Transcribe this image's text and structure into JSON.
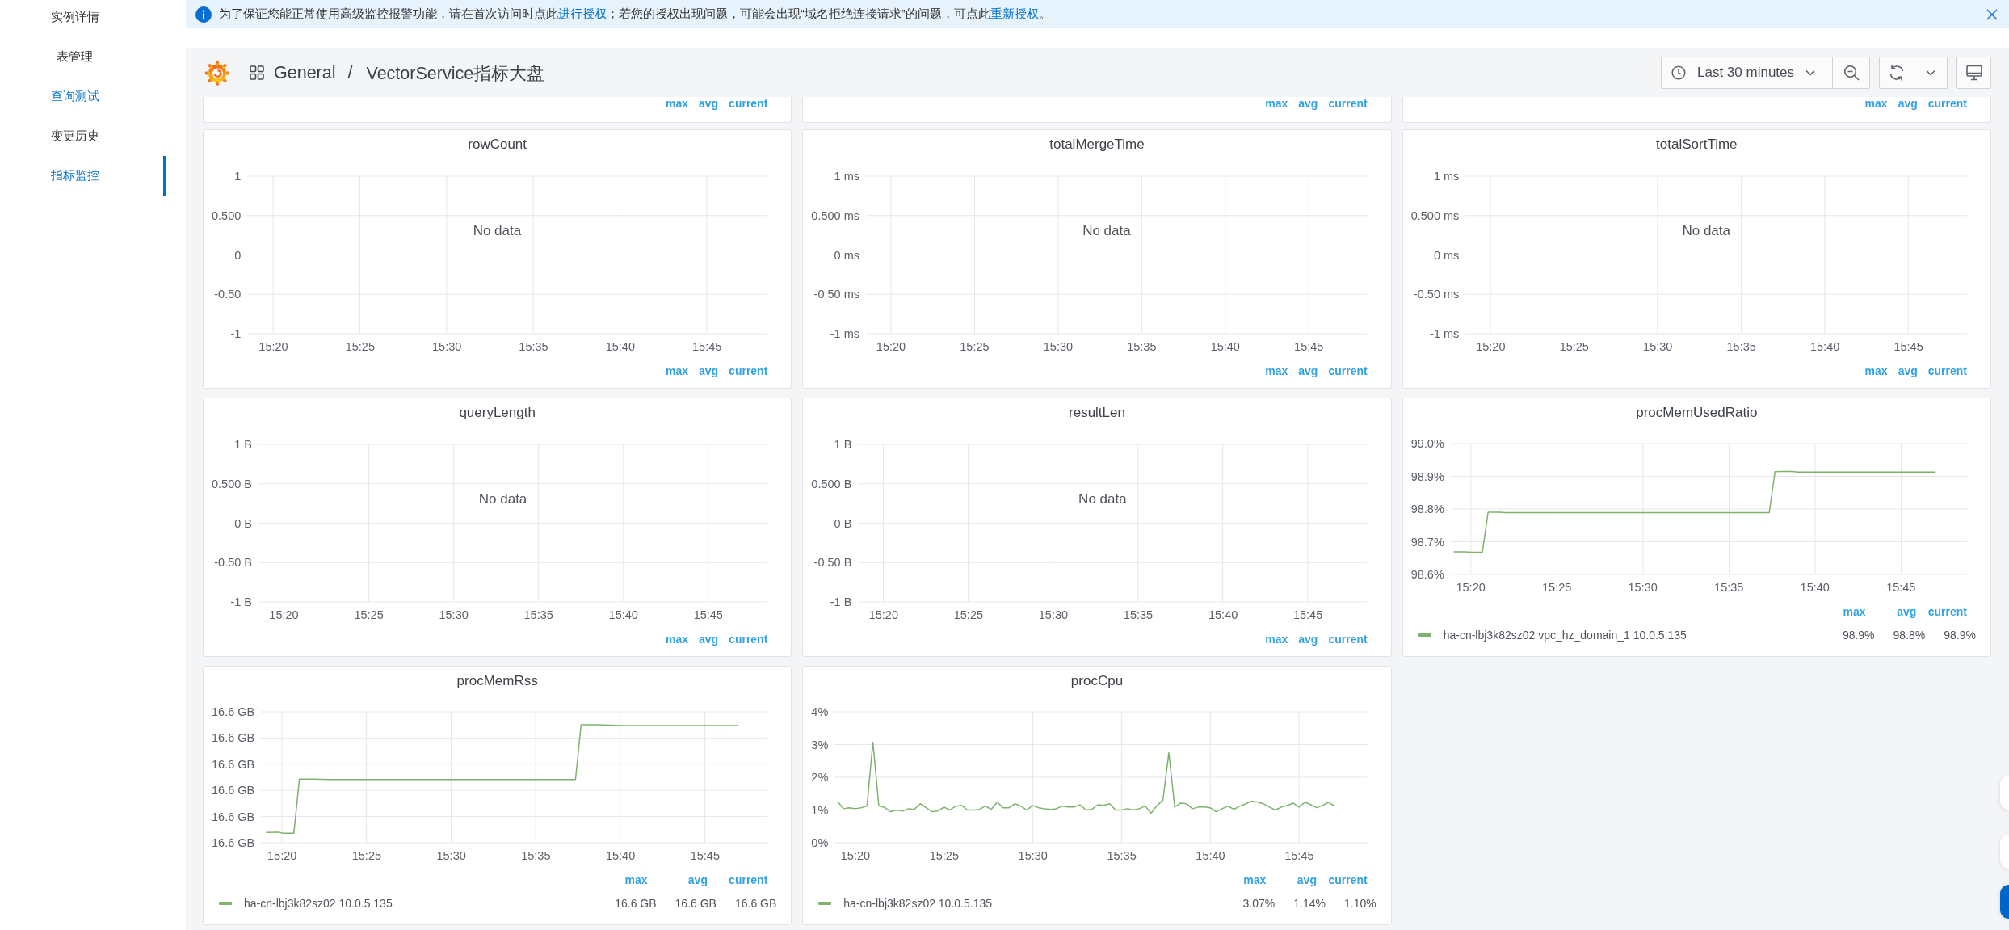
{
  "sidebar": {
    "items": [
      {
        "label": "实例详情",
        "selected": false,
        "highlighted": false
      },
      {
        "label": "表管理",
        "selected": false,
        "highlighted": false
      },
      {
        "label": "查询测试",
        "selected": false,
        "highlighted": true
      },
      {
        "label": "变更历史",
        "selected": false,
        "highlighted": false
      },
      {
        "label": "指标监控",
        "selected": true,
        "highlighted": false
      }
    ]
  },
  "notice": {
    "segments": [
      {
        "kind": "text",
        "text": "为了保证您能正常使用高级监控报警功能，请在首次访问时点此"
      },
      {
        "kind": "link",
        "text": "进行授权"
      },
      {
        "kind": "text",
        "text": "；若您的授权出现问题，可能会出现“域名拒绝连接请求”的问题，可点此"
      },
      {
        "kind": "link",
        "text": "重新授权"
      },
      {
        "kind": "text",
        "text": "。"
      }
    ]
  },
  "header": {
    "folder": "General",
    "separator": "/",
    "title": "VectorService指标大盘",
    "time_range": "Last 30 minutes"
  },
  "partial_panels": [
    {
      "legend_headers": [
        "max",
        "avg",
        "current"
      ]
    },
    {
      "legend_headers": [
        "max",
        "avg",
        "current"
      ]
    },
    {
      "legend_headers": [
        "max",
        "avg",
        "current"
      ]
    }
  ],
  "panels": [
    {
      "title": "rowCount",
      "kind": "no_data",
      "message": "No data",
      "chart_data": {
        "type": "line",
        "grid": true,
        "categories": [
          null,
          "15:20",
          null,
          null,
          null,
          null,
          "15:25",
          null,
          null,
          null,
          null,
          "15:30",
          null,
          null,
          null,
          null,
          "15:35",
          null,
          null,
          null,
          null,
          "15:40",
          null,
          null,
          null,
          null,
          "15:45",
          null,
          null,
          null
        ],
        "ylim": [
          -1,
          1
        ],
        "yticks": [
          1,
          {
            "value": 0.5,
            "label": "0.500"
          },
          0,
          {
            "value": -0.5,
            "label": "-0.50"
          },
          -1
        ]
      },
      "legend": {
        "headers": [
          "max",
          "avg",
          "current"
        ]
      }
    },
    {
      "title": "totalMergeTime",
      "kind": "no_data",
      "message": "No data",
      "chart_data": {
        "type": "line",
        "grid": true,
        "categories": [
          null,
          "15:20",
          null,
          null,
          null,
          null,
          "15:25",
          null,
          null,
          null,
          null,
          "15:30",
          null,
          null,
          null,
          null,
          "15:35",
          null,
          null,
          null,
          null,
          "15:40",
          null,
          null,
          null,
          null,
          "15:45",
          null,
          null,
          null
        ],
        "ylim": [
          -1,
          1
        ],
        "yticks": [
          {
            "value": 1,
            "label": "1 ms"
          },
          {
            "value": 0.5,
            "label": "0.500 ms"
          },
          {
            "value": 0,
            "label": "0 ms"
          },
          {
            "value": -0.5,
            "label": "-0.50 ms"
          },
          {
            "value": -1,
            "label": "-1 ms"
          }
        ]
      },
      "legend": {
        "headers": [
          "max",
          "avg",
          "current"
        ]
      }
    },
    {
      "title": "totalSortTime",
      "kind": "no_data",
      "message": "No data",
      "chart_data": {
        "type": "line",
        "grid": true,
        "categories": [
          null,
          "15:20",
          null,
          null,
          null,
          null,
          "15:25",
          null,
          null,
          null,
          null,
          "15:30",
          null,
          null,
          null,
          null,
          "15:35",
          null,
          null,
          null,
          null,
          "15:40",
          null,
          null,
          null,
          null,
          "15:45",
          null,
          null,
          null
        ],
        "ylim": [
          -1,
          1
        ],
        "yticks": [
          {
            "value": 1,
            "label": "1 ms"
          },
          {
            "value": 0.5,
            "label": "0.500 ms"
          },
          {
            "value": 0,
            "label": "0 ms"
          },
          {
            "value": -0.5,
            "label": "-0.50 ms"
          },
          {
            "value": -1,
            "label": "-1 ms"
          }
        ]
      },
      "legend": {
        "headers": [
          "max",
          "avg",
          "current"
        ]
      }
    },
    {
      "title": "queryLength",
      "kind": "no_data",
      "message": "No data",
      "chart_data": {
        "type": "line",
        "grid": true,
        "categories": [
          null,
          "15:20",
          null,
          null,
          null,
          null,
          "15:25",
          null,
          null,
          null,
          null,
          "15:30",
          null,
          null,
          null,
          null,
          "15:35",
          null,
          null,
          null,
          null,
          "15:40",
          null,
          null,
          null,
          null,
          "15:45",
          null,
          null,
          null
        ],
        "ylim": [
          -1,
          1
        ],
        "yticks": [
          {
            "value": 1,
            "label": "1 B"
          },
          {
            "value": 0.5,
            "label": "0.500 B"
          },
          {
            "value": 0,
            "label": "0 B"
          },
          {
            "value": -0.5,
            "label": "-0.50 B"
          },
          {
            "value": -1,
            "label": "-1 B"
          }
        ]
      },
      "legend": {
        "headers": [
          "max",
          "avg",
          "current"
        ]
      }
    },
    {
      "title": "resultLen",
      "kind": "no_data",
      "message": "No data",
      "chart_data": {
        "type": "line",
        "grid": true,
        "categories": [
          null,
          "15:20",
          null,
          null,
          null,
          null,
          "15:25",
          null,
          null,
          null,
          null,
          "15:30",
          null,
          null,
          null,
          null,
          "15:35",
          null,
          null,
          null,
          null,
          "15:40",
          null,
          null,
          null,
          null,
          "15:45",
          null,
          null,
          null
        ],
        "ylim": [
          -1,
          1
        ],
        "yticks": [
          {
            "value": 1,
            "label": "1 B"
          },
          {
            "value": 0.5,
            "label": "0.500 B"
          },
          {
            "value": 0,
            "label": "0 B"
          },
          {
            "value": -0.5,
            "label": "-0.50 B"
          },
          {
            "value": -1,
            "label": "-1 B"
          }
        ]
      },
      "legend": {
        "headers": [
          "max",
          "avg",
          "current"
        ]
      }
    },
    {
      "title": "procMemUsedRatio",
      "kind": "series",
      "chart_data": {
        "type": "line",
        "grid": true,
        "categories": [
          null,
          null,
          null,
          "15:20",
          null,
          null,
          null,
          null,
          null,
          null,
          null,
          null,
          null,
          null,
          null,
          null,
          null,
          null,
          "15:25",
          null,
          null,
          null,
          null,
          null,
          null,
          null,
          null,
          null,
          null,
          null,
          null,
          null,
          null,
          "15:30",
          null,
          null,
          null,
          null,
          null,
          null,
          null,
          null,
          null,
          null,
          null,
          null,
          null,
          null,
          "15:35",
          null,
          null,
          null,
          null,
          null,
          null,
          null,
          null,
          null,
          null,
          null,
          null,
          null,
          null,
          "15:40",
          null,
          null,
          null,
          null,
          null,
          null,
          null,
          null,
          null,
          null,
          null,
          null,
          null,
          null,
          "15:45",
          null,
          null,
          null,
          null,
          null,
          null,
          null,
          null,
          null,
          null,
          null
        ],
        "ylim": [
          98.6,
          99.0
        ],
        "yticks": [
          {
            "value": 99.0,
            "label": "99.0%"
          },
          {
            "value": 98.9,
            "label": "98.9%"
          },
          {
            "value": 98.8,
            "label": "98.8%"
          },
          {
            "value": 98.7,
            "label": "98.7%"
          },
          {
            "value": 98.6,
            "label": "98.6%"
          }
        ],
        "series": [
          {
            "name": "ha-cn-lbj3k82sz02 vpc_hz_domain_1 10.0.5.135",
            "color": "#7eb26d",
            "values": [
              98.669,
              98.669,
              98.669,
              98.668,
              98.668,
              98.668,
              98.79,
              98.79,
              98.79,
              98.789,
              98.789,
              98.789,
              98.789,
              98.789,
              98.789,
              98.789,
              98.789,
              98.789,
              98.789,
              98.789,
              98.789,
              98.789,
              98.789,
              98.789,
              98.789,
              98.789,
              98.789,
              98.789,
              98.789,
              98.789,
              98.789,
              98.789,
              98.789,
              98.789,
              98.789,
              98.789,
              98.789,
              98.789,
              98.789,
              98.789,
              98.789,
              98.789,
              98.789,
              98.789,
              98.789,
              98.789,
              98.789,
              98.789,
              98.789,
              98.789,
              98.789,
              98.789,
              98.789,
              98.789,
              98.789,
              98.789,
              98.914,
              98.915,
              98.915,
              98.915,
              98.913,
              98.913,
              98.913,
              98.913,
              98.913,
              98.913,
              98.913,
              98.913,
              98.913,
              98.913,
              98.913,
              98.913,
              98.913,
              98.913,
              98.913,
              98.913,
              98.913,
              98.913,
              98.913,
              98.913,
              98.913,
              98.913,
              98.913,
              98.913,
              98.913,
              null,
              null,
              null,
              null,
              null
            ]
          }
        ]
      },
      "legend": {
        "headers": [
          "max",
          "avg",
          "current"
        ],
        "rows": [
          {
            "values": [
              "98.9%",
              "98.8%",
              "98.9%"
            ]
          }
        ]
      }
    },
    {
      "title": "procMemRss",
      "kind": "sketch",
      "axis": {
        "y_labels": [
          "16.6 GB",
          "16.6 GB",
          "16.6 GB",
          "16.6 GB",
          "16.6 GB",
          "16.6 GB"
        ],
        "x_labels": [
          "15:20",
          "15:25",
          "15:30",
          "15:35",
          "15:40",
          "15:45"
        ]
      },
      "legend": {
        "headers": [
          "max",
          "avg",
          "current"
        ],
        "rows": [
          {
            "name": "ha-cn-lbj3k82sz02 10.0.5.135",
            "color": "#7eb26d",
            "values": [
              "16.6 GB",
              "16.6 GB",
              "16.6 GB"
            ]
          }
        ]
      }
    },
    {
      "title": "procCpu",
      "kind": "series",
      "chart_data": {
        "type": "line",
        "grid": true,
        "categories": [
          null,
          null,
          null,
          "15:20",
          null,
          null,
          null,
          null,
          null,
          null,
          null,
          null,
          null,
          null,
          null,
          null,
          null,
          null,
          "15:25",
          null,
          null,
          null,
          null,
          null,
          null,
          null,
          null,
          null,
          null,
          null,
          null,
          null,
          null,
          "15:30",
          null,
          null,
          null,
          null,
          null,
          null,
          null,
          null,
          null,
          null,
          null,
          null,
          null,
          null,
          "15:35",
          null,
          null,
          null,
          null,
          null,
          null,
          null,
          null,
          null,
          null,
          null,
          null,
          null,
          null,
          "15:40",
          null,
          null,
          null,
          null,
          null,
          null,
          null,
          null,
          null,
          null,
          null,
          null,
          null,
          null,
          "15:45",
          null,
          null,
          null,
          null,
          null,
          null,
          null,
          null,
          null,
          null,
          null
        ],
        "ylim": [
          0,
          4
        ],
        "yticks": [
          {
            "value": 4,
            "label": "4%"
          },
          {
            "value": 3,
            "label": "3%"
          },
          {
            "value": 2,
            "label": "2%"
          },
          {
            "value": 1,
            "label": "1%"
          },
          {
            "value": 0,
            "label": "0%"
          }
        ],
        "series": [
          {
            "name": "ha-cn-lbj3k82sz02 10.0.5.135",
            "color": "#7eb26d",
            "values": [
              1.27,
              1.04,
              1.07,
              1.04,
              1.07,
              1.12,
              3.07,
              1.13,
              1.08,
              0.95,
              1.0,
              0.97,
              1.04,
              1.02,
              1.19,
              1.07,
              0.95,
              0.97,
              1.09,
              1.0,
              1.12,
              1.14,
              1.0,
              1.0,
              1.02,
              1.12,
              1.02,
              1.24,
              1.07,
              1.07,
              1.19,
              1.12,
              1.0,
              1.14,
              1.07,
              1.04,
              1.02,
              1.04,
              1.12,
              1.09,
              1.09,
              1.16,
              1.0,
              1.02,
              1.16,
              1.14,
              1.19,
              1.0,
              1.0,
              1.04,
              1.0,
              1.04,
              1.12,
              0.9,
              1.14,
              1.3,
              2.75,
              1.09,
              1.21,
              1.19,
              1.04,
              1.09,
              1.09,
              1.07,
              0.95,
              1.04,
              1.12,
              1.02,
              1.12,
              1.19,
              1.27,
              1.24,
              1.19,
              1.09,
              1.0,
              1.09,
              1.14,
              1.21,
              1.09,
              1.24,
              1.16,
              1.07,
              1.14,
              1.24,
              1.12,
              null,
              null,
              null,
              null,
              null
            ]
          }
        ]
      },
      "legend": {
        "headers": [
          "max",
          "avg",
          "current"
        ],
        "rows": [
          {
            "values": [
              "3.07%",
              "1.14%",
              "1.10%"
            ]
          }
        ]
      }
    }
  ],
  "floating_buttons": [
    {
      "kind": "plain"
    },
    {
      "kind": "plain"
    },
    {
      "kind": "primary"
    }
  ]
}
